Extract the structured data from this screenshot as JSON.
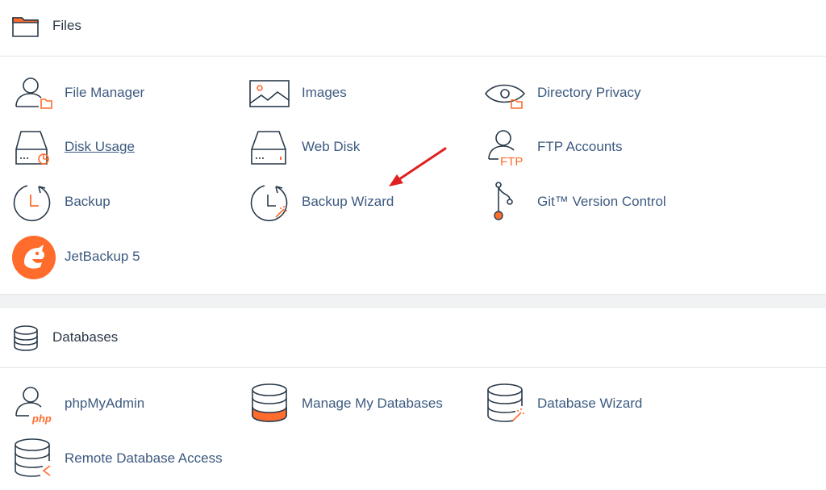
{
  "files": {
    "title": "Files",
    "items": [
      {
        "label": "File Manager",
        "icon": "file-manager-icon"
      },
      {
        "label": "Images",
        "icon": "images-icon"
      },
      {
        "label": "Directory Privacy",
        "icon": "directory-privacy-icon"
      },
      {
        "label": "Disk Usage",
        "icon": "disk-usage-icon"
      },
      {
        "label": "Web Disk",
        "icon": "web-disk-icon"
      },
      {
        "label": "FTP Accounts",
        "icon": "ftp-accounts-icon",
        "icon_text": "FTP"
      },
      {
        "label": "Backup",
        "icon": "backup-icon"
      },
      {
        "label": "Backup Wizard",
        "icon": "backup-wizard-icon"
      },
      {
        "label": "Git™ Version Control",
        "icon": "git-icon"
      },
      {
        "label": "JetBackup 5",
        "icon": "jetbackup-icon"
      }
    ]
  },
  "databases": {
    "title": "Databases",
    "items": [
      {
        "label": "phpMyAdmin",
        "icon": "phpmyadmin-icon",
        "icon_text": "php"
      },
      {
        "label": "Manage My Databases",
        "icon": "manage-databases-icon"
      },
      {
        "label": "Database Wizard",
        "icon": "database-wizard-icon"
      },
      {
        "label": "Remote Database Access",
        "icon": "remote-database-icon"
      }
    ]
  },
  "colors": {
    "accent": "#ff6c2c",
    "link": "#3d5a80",
    "icon_stroke": "#293a4a",
    "annotation_arrow": "#e02020"
  }
}
